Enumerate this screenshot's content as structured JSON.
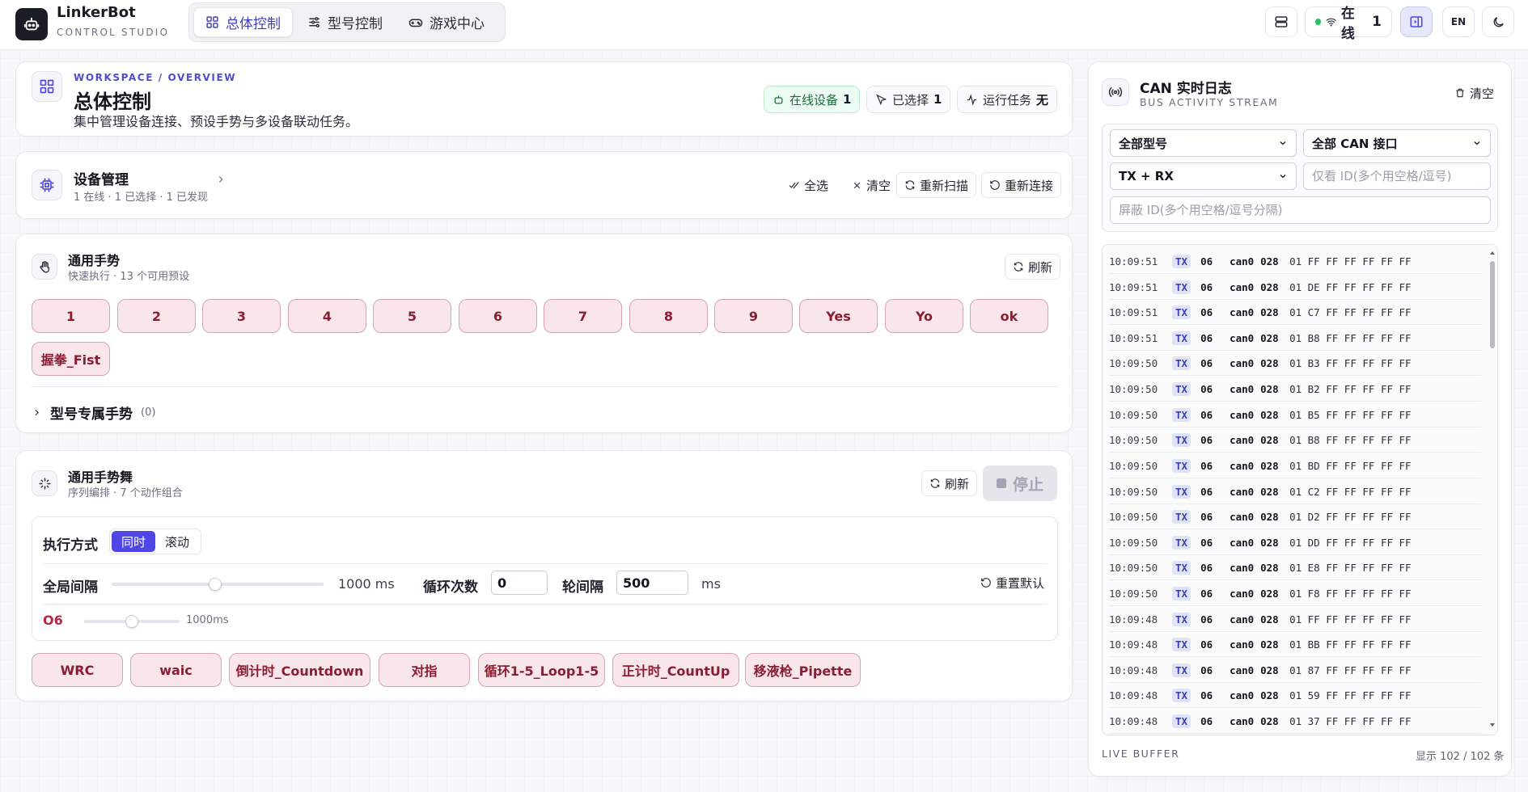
{
  "header": {
    "brand": "LinkerBot",
    "brand_sub": "CONTROL STUDIO",
    "nav": [
      {
        "label": "总体控制",
        "icon": "grid-icon",
        "active": true
      },
      {
        "label": "型号控制",
        "icon": "sliders-icon",
        "active": false
      },
      {
        "label": "游戏中心",
        "icon": "gamepad-icon",
        "active": false
      }
    ],
    "status_label": "在线",
    "status_count": "1",
    "lang": "EN"
  },
  "overview": {
    "breadcrumb": "WORKSPACE / OVERVIEW",
    "title": "总体控制",
    "subtitle": "集中管理设备连接、预设手势与多设备联动任务。",
    "chips": [
      {
        "label": "在线设备",
        "value": "1"
      },
      {
        "label": "已选择",
        "value": "1"
      },
      {
        "label": "运行任务",
        "value": "无"
      }
    ]
  },
  "devices": {
    "title": "设备管理",
    "summary": "1 在线 · 1 已选择 · 1 已发现",
    "actions": {
      "select_all": "全选",
      "clear": "清空",
      "rescan": "重新扫描",
      "reconnect": "重新连接"
    }
  },
  "gestures": {
    "title": "通用手势",
    "subtitle": "快速执行 · 13 个可用预设",
    "refresh": "刷新",
    "items": [
      "1",
      "2",
      "3",
      "4",
      "5",
      "6",
      "7",
      "8",
      "9",
      "Yes",
      "Yo",
      "ok",
      "握拳_Fist"
    ],
    "model_section": "型号专属手势",
    "model_count": "(0)"
  },
  "dance": {
    "title": "通用手势舞",
    "subtitle": "序列编排 · 7 个动作组合",
    "refresh": "刷新",
    "stop": "停止",
    "mode_label": "执行方式",
    "modes": [
      "同时",
      "滚动"
    ],
    "global_interval_label": "全局间隔",
    "global_interval_value": "1000 ms",
    "global_interval_fraction": 0.5,
    "loop_label": "循环次数",
    "loop_value": "0",
    "round_label": "轮间隔",
    "round_value": "500",
    "round_unit": "ms",
    "reset": "重置默认",
    "device_label": "O6",
    "device_interval": "1000ms",
    "device_interval_fraction": 0.5,
    "items": [
      "WRC",
      "waic",
      "倒计时_Countdown",
      "对指",
      "循环1-5_Loop1-5",
      "正计时_CountUp",
      "移液枪_Pipette"
    ]
  },
  "can": {
    "title": "CAN 实时日志",
    "subtitle": "BUS ACTIVITY STREAM",
    "clear": "清空",
    "model_select": "全部型号",
    "iface_select": "全部 CAN 接口",
    "dir_select": "TX + RX",
    "only_id_placeholder": "仅看 ID(多个用空格/逗号)",
    "block_id_placeholder": "屏蔽 ID(多个用空格/逗号分隔)",
    "footer_left": "LIVE BUFFER",
    "footer_right": "显示 102 / 102 条",
    "logs": [
      {
        "ts": "10:09:51",
        "dir": "TX",
        "dev": "06",
        "iface": "can0",
        "id": "028",
        "data": "01 FF FF FF FF FF FF"
      },
      {
        "ts": "10:09:51",
        "dir": "TX",
        "dev": "06",
        "iface": "can0",
        "id": "028",
        "data": "01 DE FF FF FF FF FF"
      },
      {
        "ts": "10:09:51",
        "dir": "TX",
        "dev": "06",
        "iface": "can0",
        "id": "028",
        "data": "01 C7 FF FF FF FF FF"
      },
      {
        "ts": "10:09:51",
        "dir": "TX",
        "dev": "06",
        "iface": "can0",
        "id": "028",
        "data": "01 B8 FF FF FF FF FF"
      },
      {
        "ts": "10:09:50",
        "dir": "TX",
        "dev": "06",
        "iface": "can0",
        "id": "028",
        "data": "01 B3 FF FF FF FF FF"
      },
      {
        "ts": "10:09:50",
        "dir": "TX",
        "dev": "06",
        "iface": "can0",
        "id": "028",
        "data": "01 B2 FF FF FF FF FF"
      },
      {
        "ts": "10:09:50",
        "dir": "TX",
        "dev": "06",
        "iface": "can0",
        "id": "028",
        "data": "01 B5 FF FF FF FF FF"
      },
      {
        "ts": "10:09:50",
        "dir": "TX",
        "dev": "06",
        "iface": "can0",
        "id": "028",
        "data": "01 B8 FF FF FF FF FF"
      },
      {
        "ts": "10:09:50",
        "dir": "TX",
        "dev": "06",
        "iface": "can0",
        "id": "028",
        "data": "01 BD FF FF FF FF FF"
      },
      {
        "ts": "10:09:50",
        "dir": "TX",
        "dev": "06",
        "iface": "can0",
        "id": "028",
        "data": "01 C2 FF FF FF FF FF"
      },
      {
        "ts": "10:09:50",
        "dir": "TX",
        "dev": "06",
        "iface": "can0",
        "id": "028",
        "data": "01 D2 FF FF FF FF FF"
      },
      {
        "ts": "10:09:50",
        "dir": "TX",
        "dev": "06",
        "iface": "can0",
        "id": "028",
        "data": "01 DD FF FF FF FF FF"
      },
      {
        "ts": "10:09:50",
        "dir": "TX",
        "dev": "06",
        "iface": "can0",
        "id": "028",
        "data": "01 E8 FF FF FF FF FF"
      },
      {
        "ts": "10:09:50",
        "dir": "TX",
        "dev": "06",
        "iface": "can0",
        "id": "028",
        "data": "01 F8 FF FF FF FF FF"
      },
      {
        "ts": "10:09:48",
        "dir": "TX",
        "dev": "06",
        "iface": "can0",
        "id": "028",
        "data": "01 FF FF FF FF FF FF"
      },
      {
        "ts": "10:09:48",
        "dir": "TX",
        "dev": "06",
        "iface": "can0",
        "id": "028",
        "data": "01 BB FF FF FF FF FF"
      },
      {
        "ts": "10:09:48",
        "dir": "TX",
        "dev": "06",
        "iface": "can0",
        "id": "028",
        "data": "01 87 FF FF FF FF FF"
      },
      {
        "ts": "10:09:48",
        "dir": "TX",
        "dev": "06",
        "iface": "can0",
        "id": "028",
        "data": "01 59 FF FF FF FF FF"
      },
      {
        "ts": "10:09:48",
        "dir": "TX",
        "dev": "06",
        "iface": "can0",
        "id": "028",
        "data": "01 37 FF FF FF FF FF"
      }
    ]
  }
}
